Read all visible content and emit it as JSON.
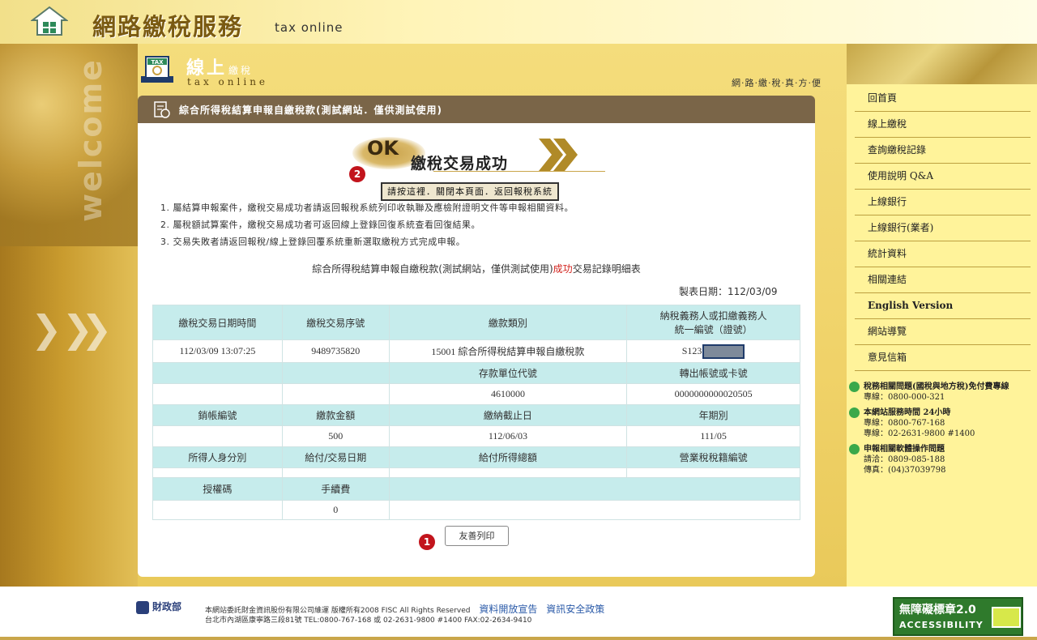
{
  "header": {
    "site_title": "網路繳稅服務",
    "site_sub": "tax online"
  },
  "section": {
    "title": "線上",
    "title_small": "繳稅",
    "sub": "tax online",
    "slogan": "網·路·繳·稅·真·方·便"
  },
  "bar_title": "綜合所得稅結算申報自繳稅款(測試網站．僅供測試使用)",
  "tax_icon_label": "TAX",
  "ok": {
    "ok_text": "OK",
    "message": "繳稅交易成功",
    "close_button": "請按這裡．關閉本頁面．返回報稅系統"
  },
  "badges": {
    "one": "1",
    "two": "2"
  },
  "notes": [
    "1. 屬結算申報案件，繳稅交易成功者請返回報稅系統列印收執聯及應檢附證明文件等申報相關資料。",
    "2. 屬稅額試算案件，繳稅交易成功者可返回線上登錄回復系統查看回復結果。",
    "3. 交易失敗者請返回報稅/線上登錄回覆系統重新選取繳稅方式完成申報。"
  ],
  "report": {
    "title_prefix": "綜合所得稅結算申報自繳稅款(測試網站，僅供測試使用)",
    "title_ok": "成功",
    "title_suffix": "交易記錄明細表",
    "date": "製表日期：112/03/09"
  },
  "table": {
    "h1": [
      "繳稅交易日期時間",
      "繳稅交易序號",
      "繳款類別",
      "納稅義務人或扣繳義務人",
      "統一編號（證號）"
    ],
    "r1": [
      "112/03/09 13:07:25",
      "9489735820",
      "15001 綜合所得稅結算申報自繳稅款",
      "S123"
    ],
    "h2": [
      "",
      "",
      "存款單位代號",
      "轉出帳號或卡號"
    ],
    "r2": [
      "",
      "",
      "4610000",
      "0000000000020505"
    ],
    "h3": [
      "銷帳編號",
      "繳款金額",
      "繳納截止日",
      "年期別"
    ],
    "r3": [
      "",
      "500",
      "112/06/03",
      "111/05"
    ],
    "h4": [
      "所得人身分別",
      "給付/交易日期",
      "給付所得總額",
      "營業稅稅籍編號"
    ],
    "r4": [
      "",
      "",
      "",
      ""
    ],
    "h5": [
      "授權碼",
      "手續費"
    ],
    "r5": [
      "",
      "0"
    ]
  },
  "print_button": "友善列印",
  "menu": [
    "回首頁",
    "線上繳稅",
    "查詢繳稅記錄",
    "使用說明 Q&A",
    "上線銀行",
    "上線銀行(業者)",
    "統計資料",
    "相關連結",
    "English Version",
    "網站導覽",
    "意見信箱"
  ],
  "contact": [
    {
      "title": "稅務相關問題(國稅與地方稅)免付費專線",
      "lines": [
        "專線：0800-000-321"
      ]
    },
    {
      "title": "本網站服務時間 24小時",
      "lines": [
        "專線：0800-767-168",
        "專線：02-2631-9800 #1400"
      ]
    },
    {
      "title": "申報相關軟體操作問題",
      "lines": [
        "請洽：0809-085-188",
        "傳真：(04)37039798"
      ]
    }
  ],
  "footer": {
    "mof": "財政部",
    "line1": "本網站委託財金資訊股份有限公司維運 版權所有2008 FISC All Rights Reserved",
    "link1": "資料開放宣告",
    "link2": "資訊安全政策",
    "line2": "台北市內湖區康寧路三段81號 TEL:0800-767-168 或 02-2631-9800 #1400 FAX:02-2634-9410"
  },
  "accessibility": {
    "title": "無障礙標章2.0",
    "sub": "ACCESSIBILITY"
  },
  "decor": {
    "welcome": "welcome"
  },
  "colors": {
    "brown_bar": "#7a6548",
    "table_header": "#c6ecec",
    "accent_red": "#d2221c",
    "menu_bg": "#fff39a"
  }
}
